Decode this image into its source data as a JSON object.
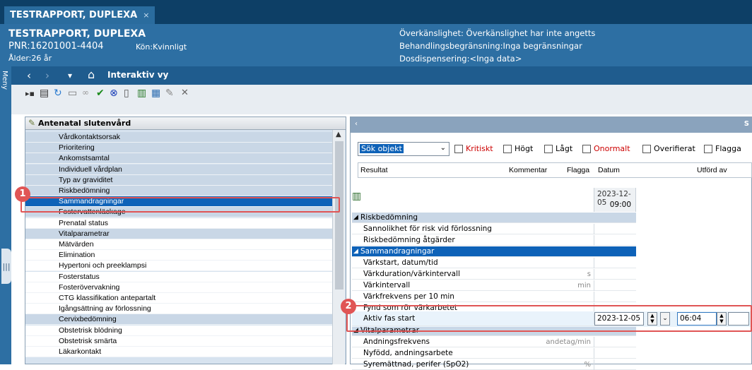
{
  "window": {
    "tab_title": "TESTRAPPORT, DUPLEXA",
    "tab_close": "×"
  },
  "patient": {
    "name": "TESTRAPPORT, DUPLEXA",
    "pnr": "PNR:16201001-4404",
    "kon": "Kön:Kvinnligt",
    "alder": "Ålder:26 år",
    "overkanslighet": "Överkänslighet: Överkänslighet har inte angetts",
    "behandling": "Behandlingsbegränsning:Inga begränsningar",
    "dosdispensering": "Dosdispensering:<Inga data>"
  },
  "nav": {
    "title": "Interaktiv vy",
    "meny": "Meny",
    "back": "‹",
    "forward": "›",
    "dropdown": "▾",
    "home": "⌂"
  },
  "toolbar_icons": [
    "pin-icon",
    "grid-icon",
    "refresh-icon",
    "card-icon",
    "glasses-icon",
    "check-icon",
    "cancel-icon",
    "document-icon",
    "chart-icon",
    "chart2-icon",
    "sign-icon",
    "close-icon"
  ],
  "left_panel": {
    "title": "Antenatal slutenvård",
    "items": [
      {
        "label": "Vårdkontaktsorsak",
        "style": "alt"
      },
      {
        "label": "Prioritering",
        "style": "alt"
      },
      {
        "label": "Ankomstsamtal",
        "style": "alt"
      },
      {
        "label": "Individuell vårdplan",
        "style": "alt"
      },
      {
        "label": "Typ av graviditet",
        "style": "alt"
      },
      {
        "label": "Riskbedömning",
        "style": "alt"
      },
      {
        "label": "Sammandragningar",
        "style": "sel"
      },
      {
        "label": "Fostervattenläckage",
        "style": "alt"
      },
      {
        "label": "Prenatal status",
        "style": "plain"
      },
      {
        "label": "Vitalparametrar",
        "style": "alt"
      },
      {
        "label": "Mätvärden",
        "style": "plain"
      },
      {
        "label": "Elimination",
        "style": "plain"
      },
      {
        "label": "Hypertoni och preeklampsi",
        "style": "plain"
      },
      {
        "label": "Fosterstatus",
        "style": "plain"
      },
      {
        "label": "Fosterövervakning",
        "style": "plain"
      },
      {
        "label": "CTG klassifikation antepartalt",
        "style": "plain"
      },
      {
        "label": "Igångsättning av förlossning",
        "style": "plain"
      },
      {
        "label": "Cervixbedömning",
        "style": "alt"
      },
      {
        "label": "Obstetrisk blödning",
        "style": "plain"
      },
      {
        "label": "Obstetrisk smärta",
        "style": "plain"
      },
      {
        "label": "Läkarkontakt",
        "style": "plain"
      }
    ]
  },
  "right_panel": {
    "top_left": "‹",
    "top_right": "S",
    "search": {
      "selected": "Sök objekt"
    },
    "filters": [
      {
        "label": "Kritiskt",
        "red": true
      },
      {
        "label": "Högt",
        "red": false
      },
      {
        "label": "Lågt",
        "red": false
      },
      {
        "label": "Onormalt",
        "red": true
      },
      {
        "label": "Overifierat",
        "red": false
      },
      {
        "label": "Flagga",
        "red": false
      }
    ],
    "columns": [
      "Resultat",
      "Kommentar",
      "Flagga",
      "Datum",
      "Utförd av"
    ],
    "date_header": {
      "date": "2023-12-05",
      "time": "09:00"
    },
    "rows": [
      {
        "label": "Riskbedömning",
        "type": "sec"
      },
      {
        "label": "Sannolikhet för risk vid förlossning",
        "type": "row",
        "unit": ""
      },
      {
        "label": "Riskbedömning åtgärder",
        "type": "row",
        "unit": ""
      },
      {
        "label": "Sammandragningar",
        "type": "secsel"
      },
      {
        "label": "Värkstart, datum/tid",
        "type": "row",
        "unit": ""
      },
      {
        "label": "Värkduration/värkintervall",
        "type": "row",
        "unit": "s"
      },
      {
        "label": "Värkintervall",
        "type": "row",
        "unit": "min"
      },
      {
        "label": "Värkfrekvens per 10 min",
        "type": "row",
        "unit": ""
      },
      {
        "label": "Fynd som rör värkarbetet",
        "type": "row",
        "unit": ""
      },
      {
        "label": "Aktiv fas start",
        "type": "active",
        "unit": ""
      },
      {
        "label": "Vitalparametrar",
        "type": "sec"
      },
      {
        "label": "Andningsfrekvens",
        "type": "row",
        "unit": "andetag/min"
      },
      {
        "label": "Nyfödd, andningsarbete",
        "type": "row",
        "unit": ""
      },
      {
        "label": "Syremättnad, perifer (SpO2)",
        "type": "row",
        "unit": "%"
      }
    ],
    "edit": {
      "date": "2023-12-05",
      "time": "06:04"
    }
  },
  "callouts": [
    "1",
    "2"
  ]
}
